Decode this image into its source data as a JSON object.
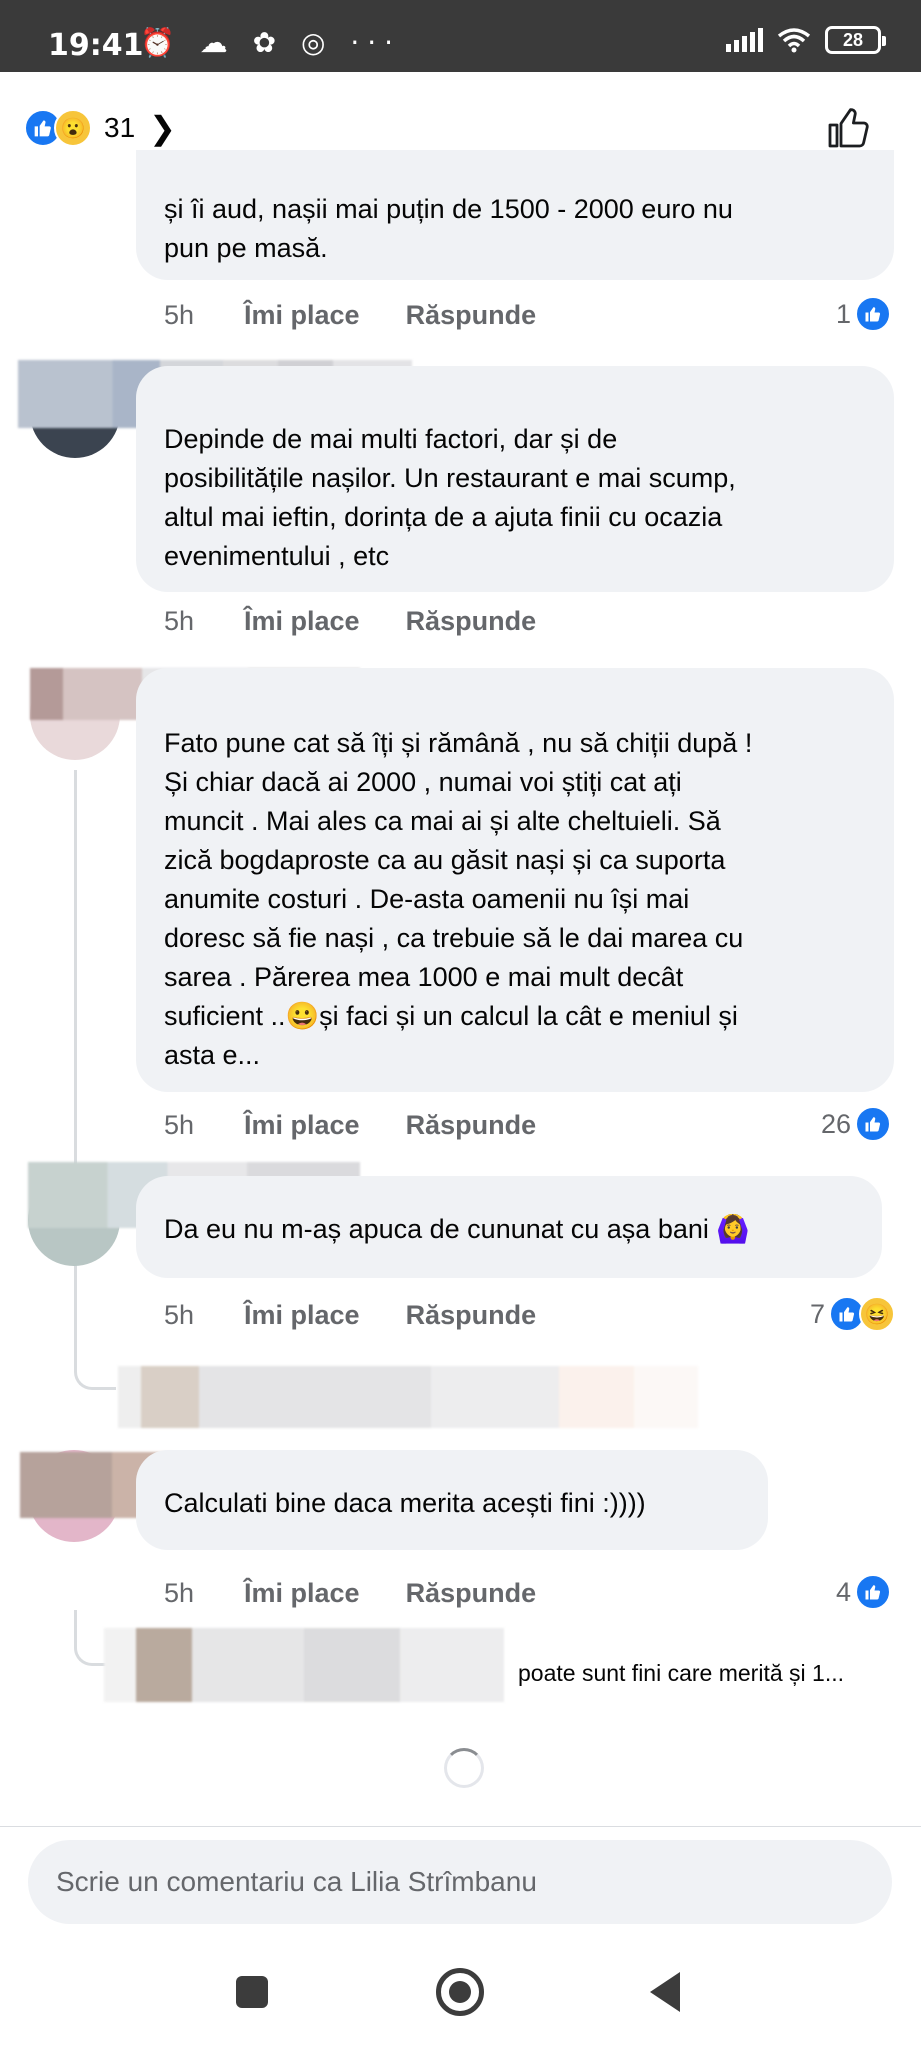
{
  "status_bar": {
    "time": "19:41",
    "notif_icons": "⏰ ☁ ✿ ◎ ···",
    "battery": "28"
  },
  "reactions_header": {
    "count": "31"
  },
  "comments": [
    {
      "text_lines": [
        "și îi aud, nașii mai puțin de 1500 - 2000 euro nu",
        "pun pe masă."
      ],
      "time": "5h",
      "like": "Îmi place",
      "reply": "Răspunde",
      "reaction_count": "1"
    },
    {
      "text_lines": [
        "Depinde de mai multi factori, dar și de",
        "posibilitățile nașilor. Un restaurant e mai scump,",
        "altul mai ieftin, dorința de a ajuta finii cu ocazia",
        "evenimentului , etc"
      ],
      "time": "5h",
      "like": "Îmi place",
      "reply": "Răspunde"
    },
    {
      "text_lines": [
        "Fato pune cat să îți și rămână , nu să chiții după !",
        "Și chiar dacă ai 2000 , numai voi știți cat ați",
        "muncit . Mai ales ca mai ai și alte cheltuieli. Să",
        "zică bogdaproste  ca au găsit nași și ca suporta",
        "anumite costuri . De-asta oamenii nu își mai",
        "doresc să fie nași , ca trebuie să le dai marea cu",
        "sarea . Părerea mea 1000 e mai mult decât",
        "suficient ..😀și faci și un calcul la cât e meniul și",
        "asta e..."
      ],
      "time": "5h",
      "like": "Îmi place",
      "reply": "Răspunde",
      "reaction_count": "26"
    },
    {
      "text_lines": [
        "Da eu nu m-aș apuca de cununat cu așa bani 🙆‍♀️"
      ],
      "time": "5h",
      "like": "Îmi place",
      "reply": "Răspunde",
      "reaction_count": "7"
    },
    {
      "text_lines": [
        "Calculati bine daca merita acești fini :))))"
      ],
      "time": "5h",
      "like": "Îmi place",
      "reply": "Răspunde",
      "reaction_count": "4"
    }
  ],
  "reply_preview": "poate sunt fini care merită și 1...",
  "comment_input": {
    "placeholder": "Scrie un comentariu ca Lilia Strîmbanu"
  },
  "colors": {
    "like_blue": "#1877f2",
    "bubble_gray": "#f0f2f5",
    "meta_gray": "#65676b"
  }
}
